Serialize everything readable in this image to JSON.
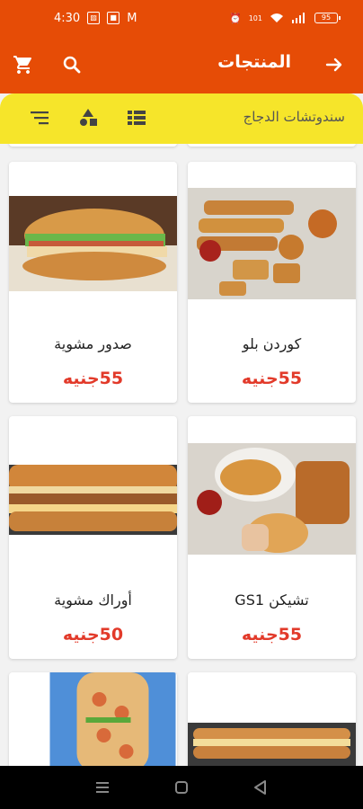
{
  "status_bar": {
    "time": "4:30",
    "network_badge": "101",
    "battery": "95"
  },
  "app_bar": {
    "title": "المنتجات"
  },
  "filter_bar": {
    "title": "سندوتشات الدجاج"
  },
  "products": [
    {
      "name": "كوردن بلو",
      "price": "55جنيه"
    },
    {
      "name": "صدور مشوية",
      "price": "55جنيه"
    },
    {
      "name": "تشيكن GS1",
      "price": "55جنيه"
    },
    {
      "name": "أوراك مشوية",
      "price": "50جنيه"
    }
  ],
  "colors": {
    "primary": "#e64c06",
    "filter_bg": "#f6e52a",
    "price": "#e23a2a"
  },
  "icons": [
    "back-arrow-icon",
    "search-icon",
    "cart-icon",
    "sort-icon",
    "shapes-icon",
    "view-list-icon",
    "menu-nav-icon",
    "home-nav-icon",
    "back-nav-icon"
  ]
}
